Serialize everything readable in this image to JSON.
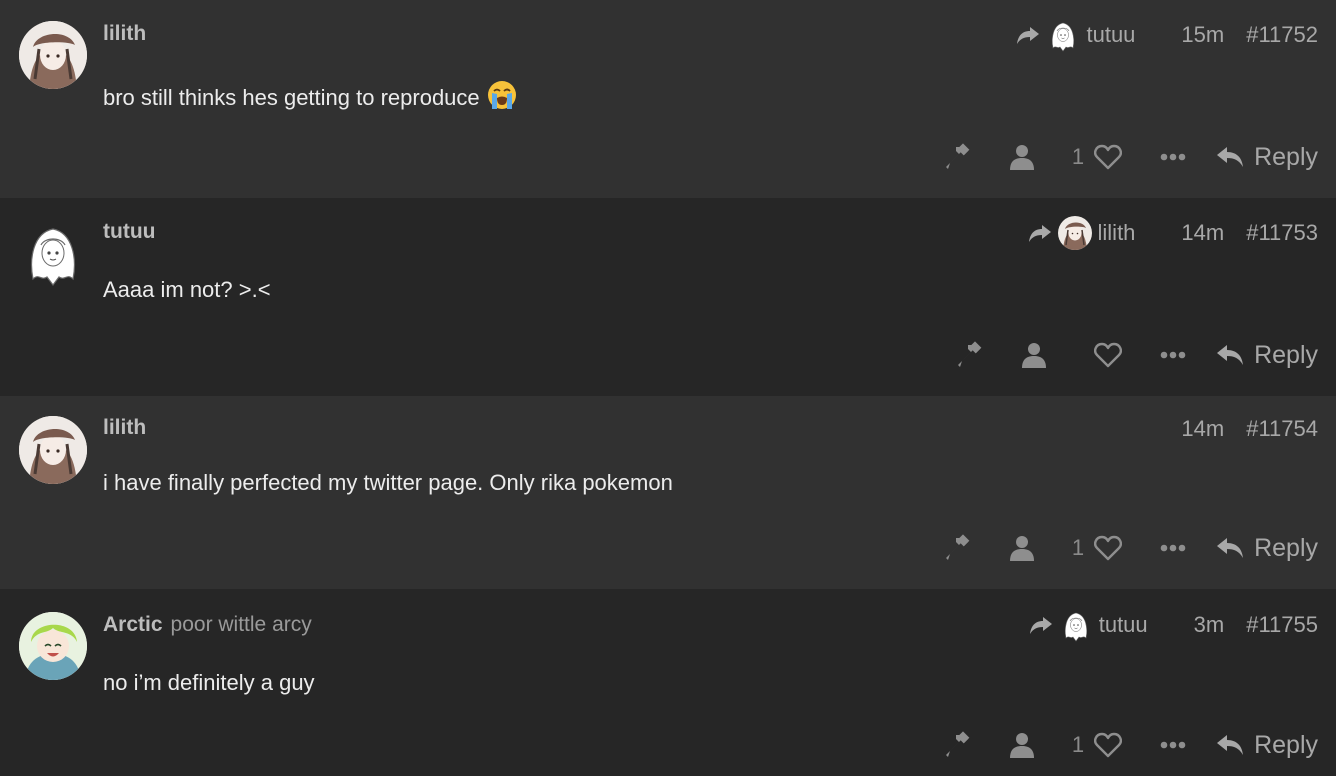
{
  "posts": [
    {
      "username": "lilith",
      "user_title": "",
      "avatar": "lilith-avatar",
      "reply_to": {
        "username": "tutuu",
        "avatar": "tutuu-avatar"
      },
      "time": "15m",
      "post_number": "#11752",
      "content": "bro still thinks hes getting to reproduce",
      "content_emoji": "loudly-crying-face",
      "like_count": "1",
      "reply_label": "Reply"
    },
    {
      "username": "tutuu",
      "user_title": "",
      "avatar": "tutuu-avatar",
      "reply_to": {
        "username": "lilith",
        "avatar": "lilith-avatar"
      },
      "time": "14m",
      "post_number": "#11753",
      "content": "Aaaa im not? >.<",
      "like_count": "",
      "reply_label": "Reply"
    },
    {
      "username": "lilith",
      "user_title": "",
      "avatar": "lilith-avatar",
      "time": "14m",
      "post_number": "#11754",
      "content": "i have finally perfected my twitter page. Only rika pokemon",
      "like_count": "1",
      "reply_label": "Reply"
    },
    {
      "username": "Arctic",
      "user_title": "poor wittle arcy",
      "avatar": "arctic-avatar",
      "reply_to": {
        "username": "tutuu",
        "avatar": "tutuu-avatar"
      },
      "time": "3m",
      "post_number": "#11755",
      "content": "no i’m definitely a guy",
      "like_count": "1",
      "reply_label": "Reply"
    }
  ],
  "icons": {
    "share": "share-arrow-icon",
    "flag": "hammer-icon",
    "user": "user-icon",
    "like": "heart-icon",
    "more": "ellipsis-icon",
    "reply": "reply-arrow-icon"
  },
  "colors": {
    "post_bg_alt": "#313131",
    "post_bg": "#262626",
    "username": "#bdbdbd",
    "meta": "#a8a8a8",
    "text": "#ececec"
  }
}
